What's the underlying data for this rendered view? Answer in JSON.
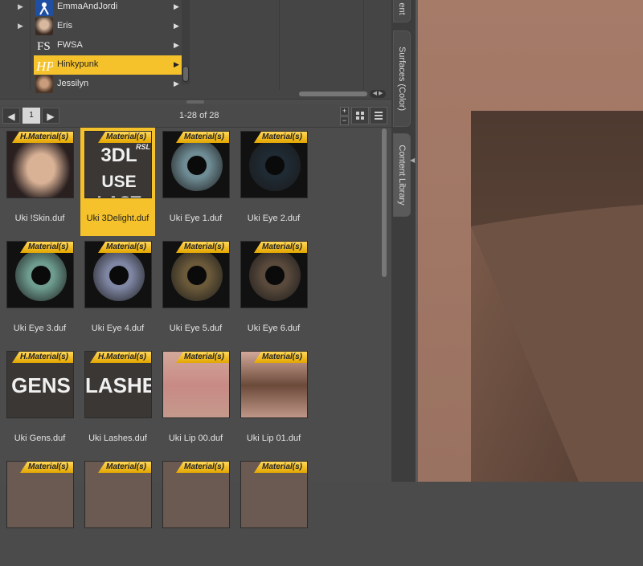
{
  "tree": {
    "items": [
      {
        "label": "EmmaAndJordi",
        "icon": "emma-jordi-icon",
        "selected": false
      },
      {
        "label": "Eris",
        "icon": "eris-portrait-icon",
        "selected": false
      },
      {
        "label": "FWSA",
        "icon": "fwsa-logo-icon",
        "selected": false
      },
      {
        "label": "Hinkypunk",
        "icon": "hinkypunk-logo-icon",
        "selected": true
      },
      {
        "label": "Jessilyn",
        "icon": "jessilyn-portrait-icon",
        "selected": false
      }
    ],
    "expand_glyph": "▶",
    "submenu_glyph": "▶"
  },
  "toolbar": {
    "prev_glyph": "◀",
    "next_glyph": "▶",
    "page": "1",
    "count_text": "1-28 of 28",
    "zoom_in": "+",
    "zoom_out": "−"
  },
  "tiles": [
    {
      "label": "Uki !Skin.duf",
      "badge": "H.Material(s)",
      "kind": "face",
      "selected": false
    },
    {
      "label": "Uki 3Delight.duf",
      "badge": "Material(s)",
      "kind": "text",
      "text1": "3DL",
      "text2": "USE LAST",
      "tag": "RSL",
      "selected": true
    },
    {
      "label": "Uki Eye 1.duf",
      "badge": "Material(s)",
      "kind": "eye",
      "color": "#6f8c94",
      "selected": false
    },
    {
      "label": "Uki Eye 2.duf",
      "badge": "Material(s)",
      "kind": "eye",
      "color": "#1f2a33",
      "selected": false
    },
    {
      "label": "Uki Eye 3.duf",
      "badge": "Material(s)",
      "kind": "eye",
      "color": "#6e9c8f",
      "selected": false
    },
    {
      "label": "Uki Eye 4.duf",
      "badge": "Material(s)",
      "kind": "eye",
      "color": "#7f86a3",
      "selected": false
    },
    {
      "label": "Uki Eye 5.duf",
      "badge": "Material(s)",
      "kind": "eye",
      "color": "#6b5a3a",
      "selected": false
    },
    {
      "label": "Uki Eye 6.duf",
      "badge": "Material(s)",
      "kind": "eye",
      "color": "#5a4a3c",
      "selected": false
    },
    {
      "label": "Uki Gens.duf",
      "badge": "H.Material(s)",
      "kind": "text",
      "text1": "GENS",
      "text2": "",
      "tag": "",
      "selected": false
    },
    {
      "label": "Uki Lashes.duf",
      "badge": "H.Material(s)",
      "kind": "text",
      "text1": "LASHES",
      "text2": "",
      "tag": "",
      "selected": false
    },
    {
      "label": "Uki Lip 00.duf",
      "badge": "Material(s)",
      "kind": "lip",
      "color": "#c88a85",
      "selected": false
    },
    {
      "label": "Uki Lip 01.duf",
      "badge": "Material(s)",
      "kind": "lip",
      "color": "#6b4a3a",
      "selected": false
    },
    {
      "label": "",
      "badge": "Material(s)",
      "kind": "partial",
      "selected": false
    },
    {
      "label": "",
      "badge": "Material(s)",
      "kind": "partial",
      "selected": false
    },
    {
      "label": "",
      "badge": "Material(s)",
      "kind": "partial",
      "selected": false
    },
    {
      "label": "",
      "badge": "Material(s)",
      "kind": "partial",
      "selected": false
    }
  ],
  "side_tabs": [
    {
      "label": "ent"
    },
    {
      "label": "Surfaces (Color)"
    },
    {
      "label": "Content Library"
    }
  ],
  "colors": {
    "accent": "#f5c22b",
    "badge_gold": "#ffd75a",
    "viewport_wall": "#9b7463"
  }
}
